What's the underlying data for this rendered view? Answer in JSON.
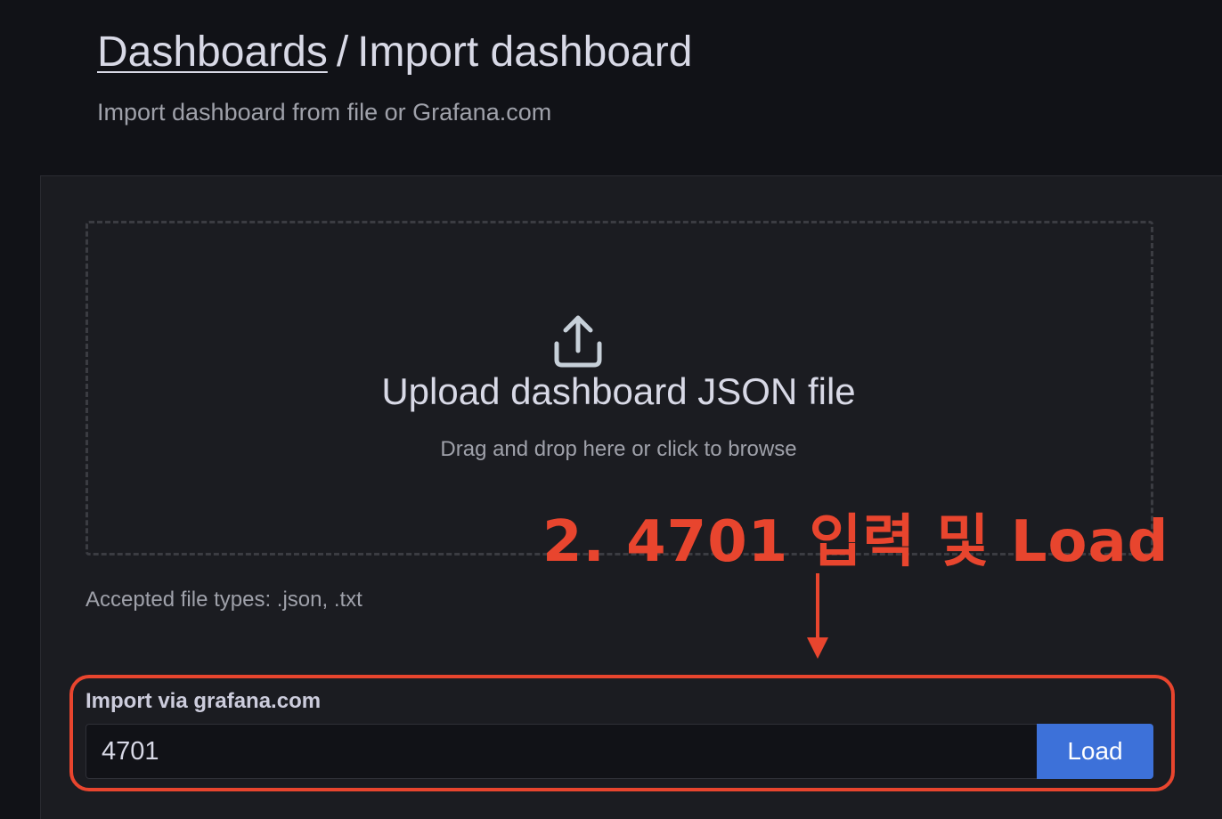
{
  "header": {
    "breadcrumb_link": "Dashboards",
    "separator": "/",
    "breadcrumb_current": "Import dashboard",
    "subtitle": "Import dashboard from file or Grafana.com"
  },
  "upload": {
    "icon": "upload-icon",
    "title": "Upload dashboard JSON file",
    "hint": "Drag and drop here or click to browse",
    "accepted_types": "Accepted file types: .json, .txt"
  },
  "annotation": {
    "text": "2. 4701 입력 및 Load",
    "color": "#e8452e"
  },
  "grafana_com": {
    "label": "Import via grafana.com",
    "value": "4701",
    "load_label": "Load"
  },
  "colors": {
    "background": "#111217",
    "panel": "#1b1c21",
    "primary_button": "#3d71d9",
    "annotation": "#e8452e"
  }
}
